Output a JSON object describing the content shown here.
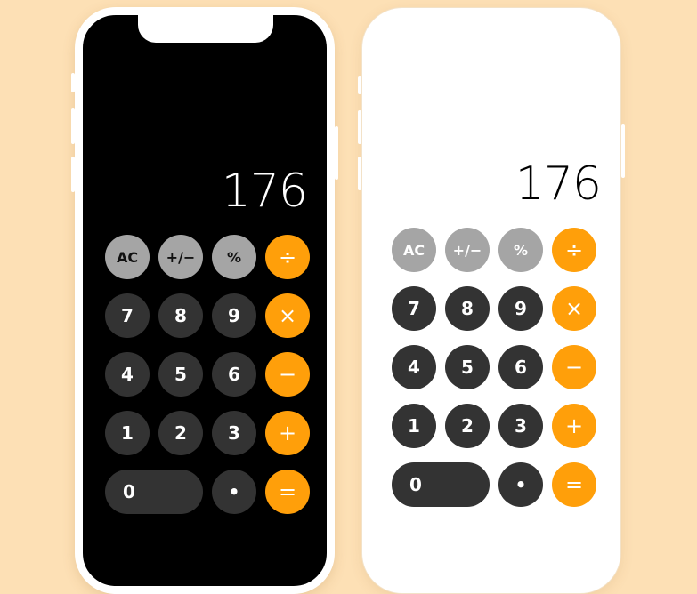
{
  "display_value": "176",
  "keys": {
    "clear": "AC",
    "sign": "+/−",
    "percent": "%",
    "divide": "÷",
    "seven": "7",
    "eight": "8",
    "nine": "9",
    "multiply": "×",
    "four": "4",
    "five": "5",
    "six": "6",
    "subtract": "−",
    "one": "1",
    "two": "2",
    "three": "3",
    "add": "+",
    "zero": "0",
    "decimal": "•",
    "equals": "="
  },
  "colors": {
    "background": "#fde0b5",
    "function_key": "#a5a5a5",
    "number_key": "#333333",
    "operator_key": "#ff9f0a"
  }
}
